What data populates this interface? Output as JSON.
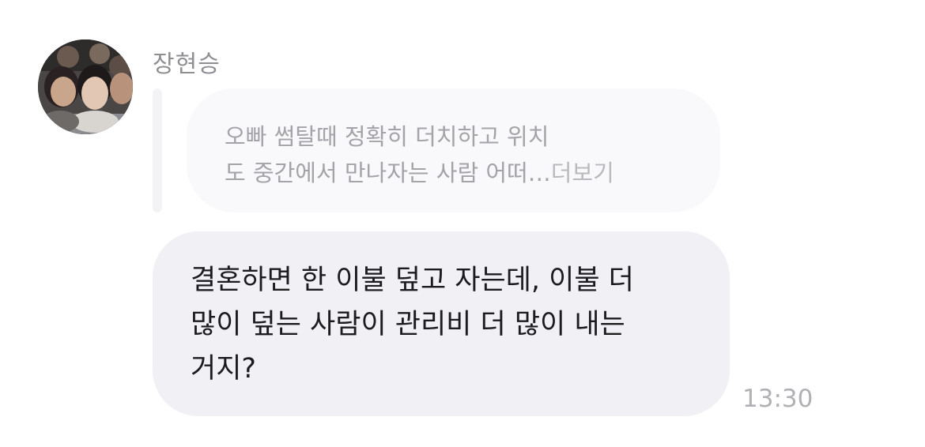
{
  "sender": {
    "name": "장현승"
  },
  "reply_preview": {
    "line1": "오빠 썸탈때 정확히 더치하고 위치",
    "line2": "도 중간에서 만나자는 사람  어떠",
    "ellipsis": "…",
    "more_label": "더보기"
  },
  "message": {
    "lines": [
      "결혼하면 한 이불 덮고 자는데, 이불 더",
      "많이 덮는 사람이 관리비 더 많이 내는",
      "거지?"
    ],
    "time": "13:30"
  },
  "colors": {
    "reply_bubble": "#f9f9fb",
    "message_bubble": "#f1f1f5",
    "reply_bar": "#f3f3f6",
    "secondary_text": "#8e8e93"
  }
}
